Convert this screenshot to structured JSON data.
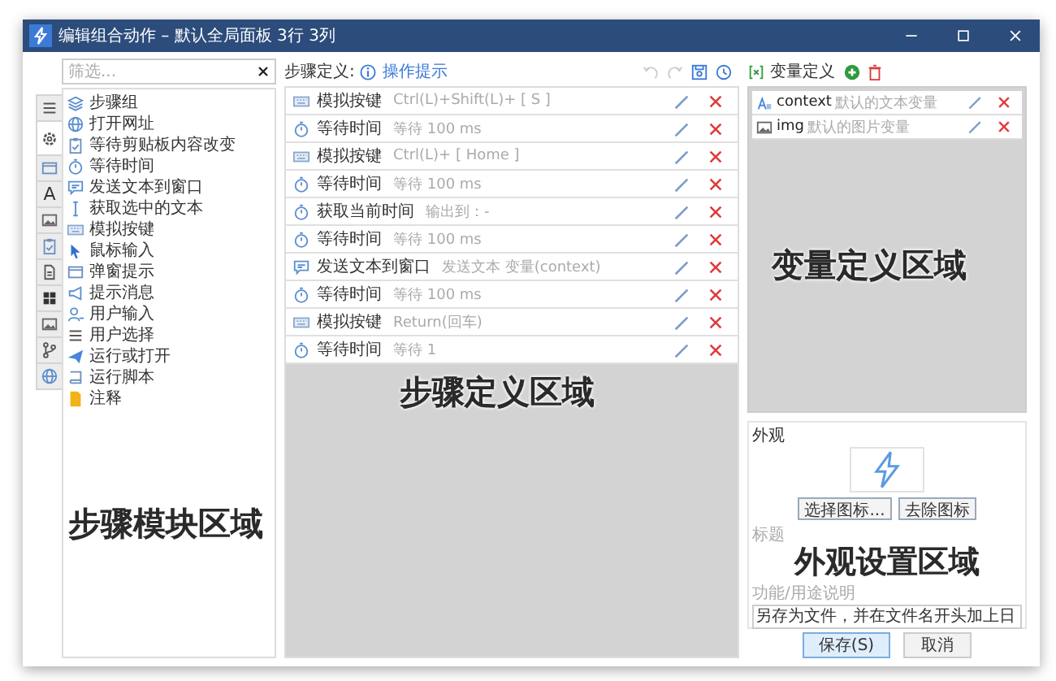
{
  "window": {
    "title": "编辑组合动作 – 默认全局面板 3行 3列"
  },
  "modules": {
    "filter": {
      "placeholder": "筛选..."
    },
    "tabs": [
      {
        "kind": "list",
        "selected": false
      },
      {
        "kind": "gear",
        "selected": true
      },
      {
        "kind": "window",
        "selected": false
      },
      {
        "kind": "glyph",
        "glyph": "A",
        "selected": false
      },
      {
        "kind": "image",
        "selected": false
      },
      {
        "kind": "clipboard",
        "selected": false
      },
      {
        "kind": "document",
        "selected": false
      },
      {
        "kind": "tiles",
        "selected": false
      },
      {
        "kind": "image",
        "selected": false
      },
      {
        "kind": "branch",
        "selected": false
      },
      {
        "kind": "globe",
        "selected": false
      }
    ],
    "items": [
      {
        "kind": "layers",
        "label": "步骤组"
      },
      {
        "kind": "globe",
        "label": "打开网址"
      },
      {
        "kind": "clipboard",
        "label": "等待剪贴板内容改变"
      },
      {
        "kind": "clock",
        "label": "等待时间"
      },
      {
        "kind": "chat",
        "label": "发送文本到窗口"
      },
      {
        "kind": "cursor",
        "label": "获取选中的文本"
      },
      {
        "kind": "keyboard",
        "label": "模拟按键"
      },
      {
        "kind": "pointer",
        "label": "鼠标输入"
      },
      {
        "kind": "window",
        "label": "弹窗提示"
      },
      {
        "kind": "megaphone",
        "label": "提示消息"
      },
      {
        "kind": "user",
        "label": "用户输入"
      },
      {
        "kind": "list",
        "label": "用户选择"
      },
      {
        "kind": "plane",
        "label": "运行或打开"
      },
      {
        "kind": "script",
        "label": "运行脚本"
      },
      {
        "kind": "note",
        "label": "注释"
      }
    ],
    "overlay_label": "步骤模块区域"
  },
  "steps": {
    "label": "步骤定义:",
    "hint_link": "操作提示",
    "rows": [
      {
        "kind": "keyboard",
        "name": "模拟按键",
        "detail": "Ctrl(L)+Shift(L)+ [ S ]"
      },
      {
        "kind": "clock",
        "name": "等待时间",
        "detail": "等待 100 ms"
      },
      {
        "kind": "keyboard",
        "name": "模拟按键",
        "detail": "Ctrl(L)+ [ Home ]"
      },
      {
        "kind": "clock",
        "name": "等待时间",
        "detail": "等待 100 ms"
      },
      {
        "kind": "clock",
        "name": "获取当前时间",
        "detail": "输出到：-"
      },
      {
        "kind": "clock",
        "name": "等待时间",
        "detail": "等待 100 ms"
      },
      {
        "kind": "chat",
        "name": "发送文本到窗口",
        "detail": "发送文本 变量(context)"
      },
      {
        "kind": "clock",
        "name": "等待时间",
        "detail": "等待 100 ms"
      },
      {
        "kind": "keyboard",
        "name": "模拟按键",
        "detail": "Return(回车)"
      },
      {
        "kind": "clock",
        "name": "等待时间",
        "detail": "等待 1"
      }
    ],
    "overlay_label": "步骤定义区域"
  },
  "variables": {
    "title": "变量定义",
    "items": [
      {
        "kind": "text",
        "name": "context",
        "description": "默认的文本变量"
      },
      {
        "kind": "image",
        "name": "img",
        "description": "默认的图片变量"
      }
    ],
    "overlay_label": "变量定义区域"
  },
  "appearance": {
    "title": "外观",
    "buttons": [
      "选择图标...",
      "去除图标"
    ],
    "title_label": "标题",
    "description_label": "功能/用途说明",
    "description": "另存为文件，并在文件名开头加上日",
    "overlay_label": "外观设置区域"
  },
  "footer": {
    "buttons": [
      {
        "label": "保存(S)",
        "primary": true
      },
      {
        "label": "取消",
        "primary": false
      }
    ]
  }
}
